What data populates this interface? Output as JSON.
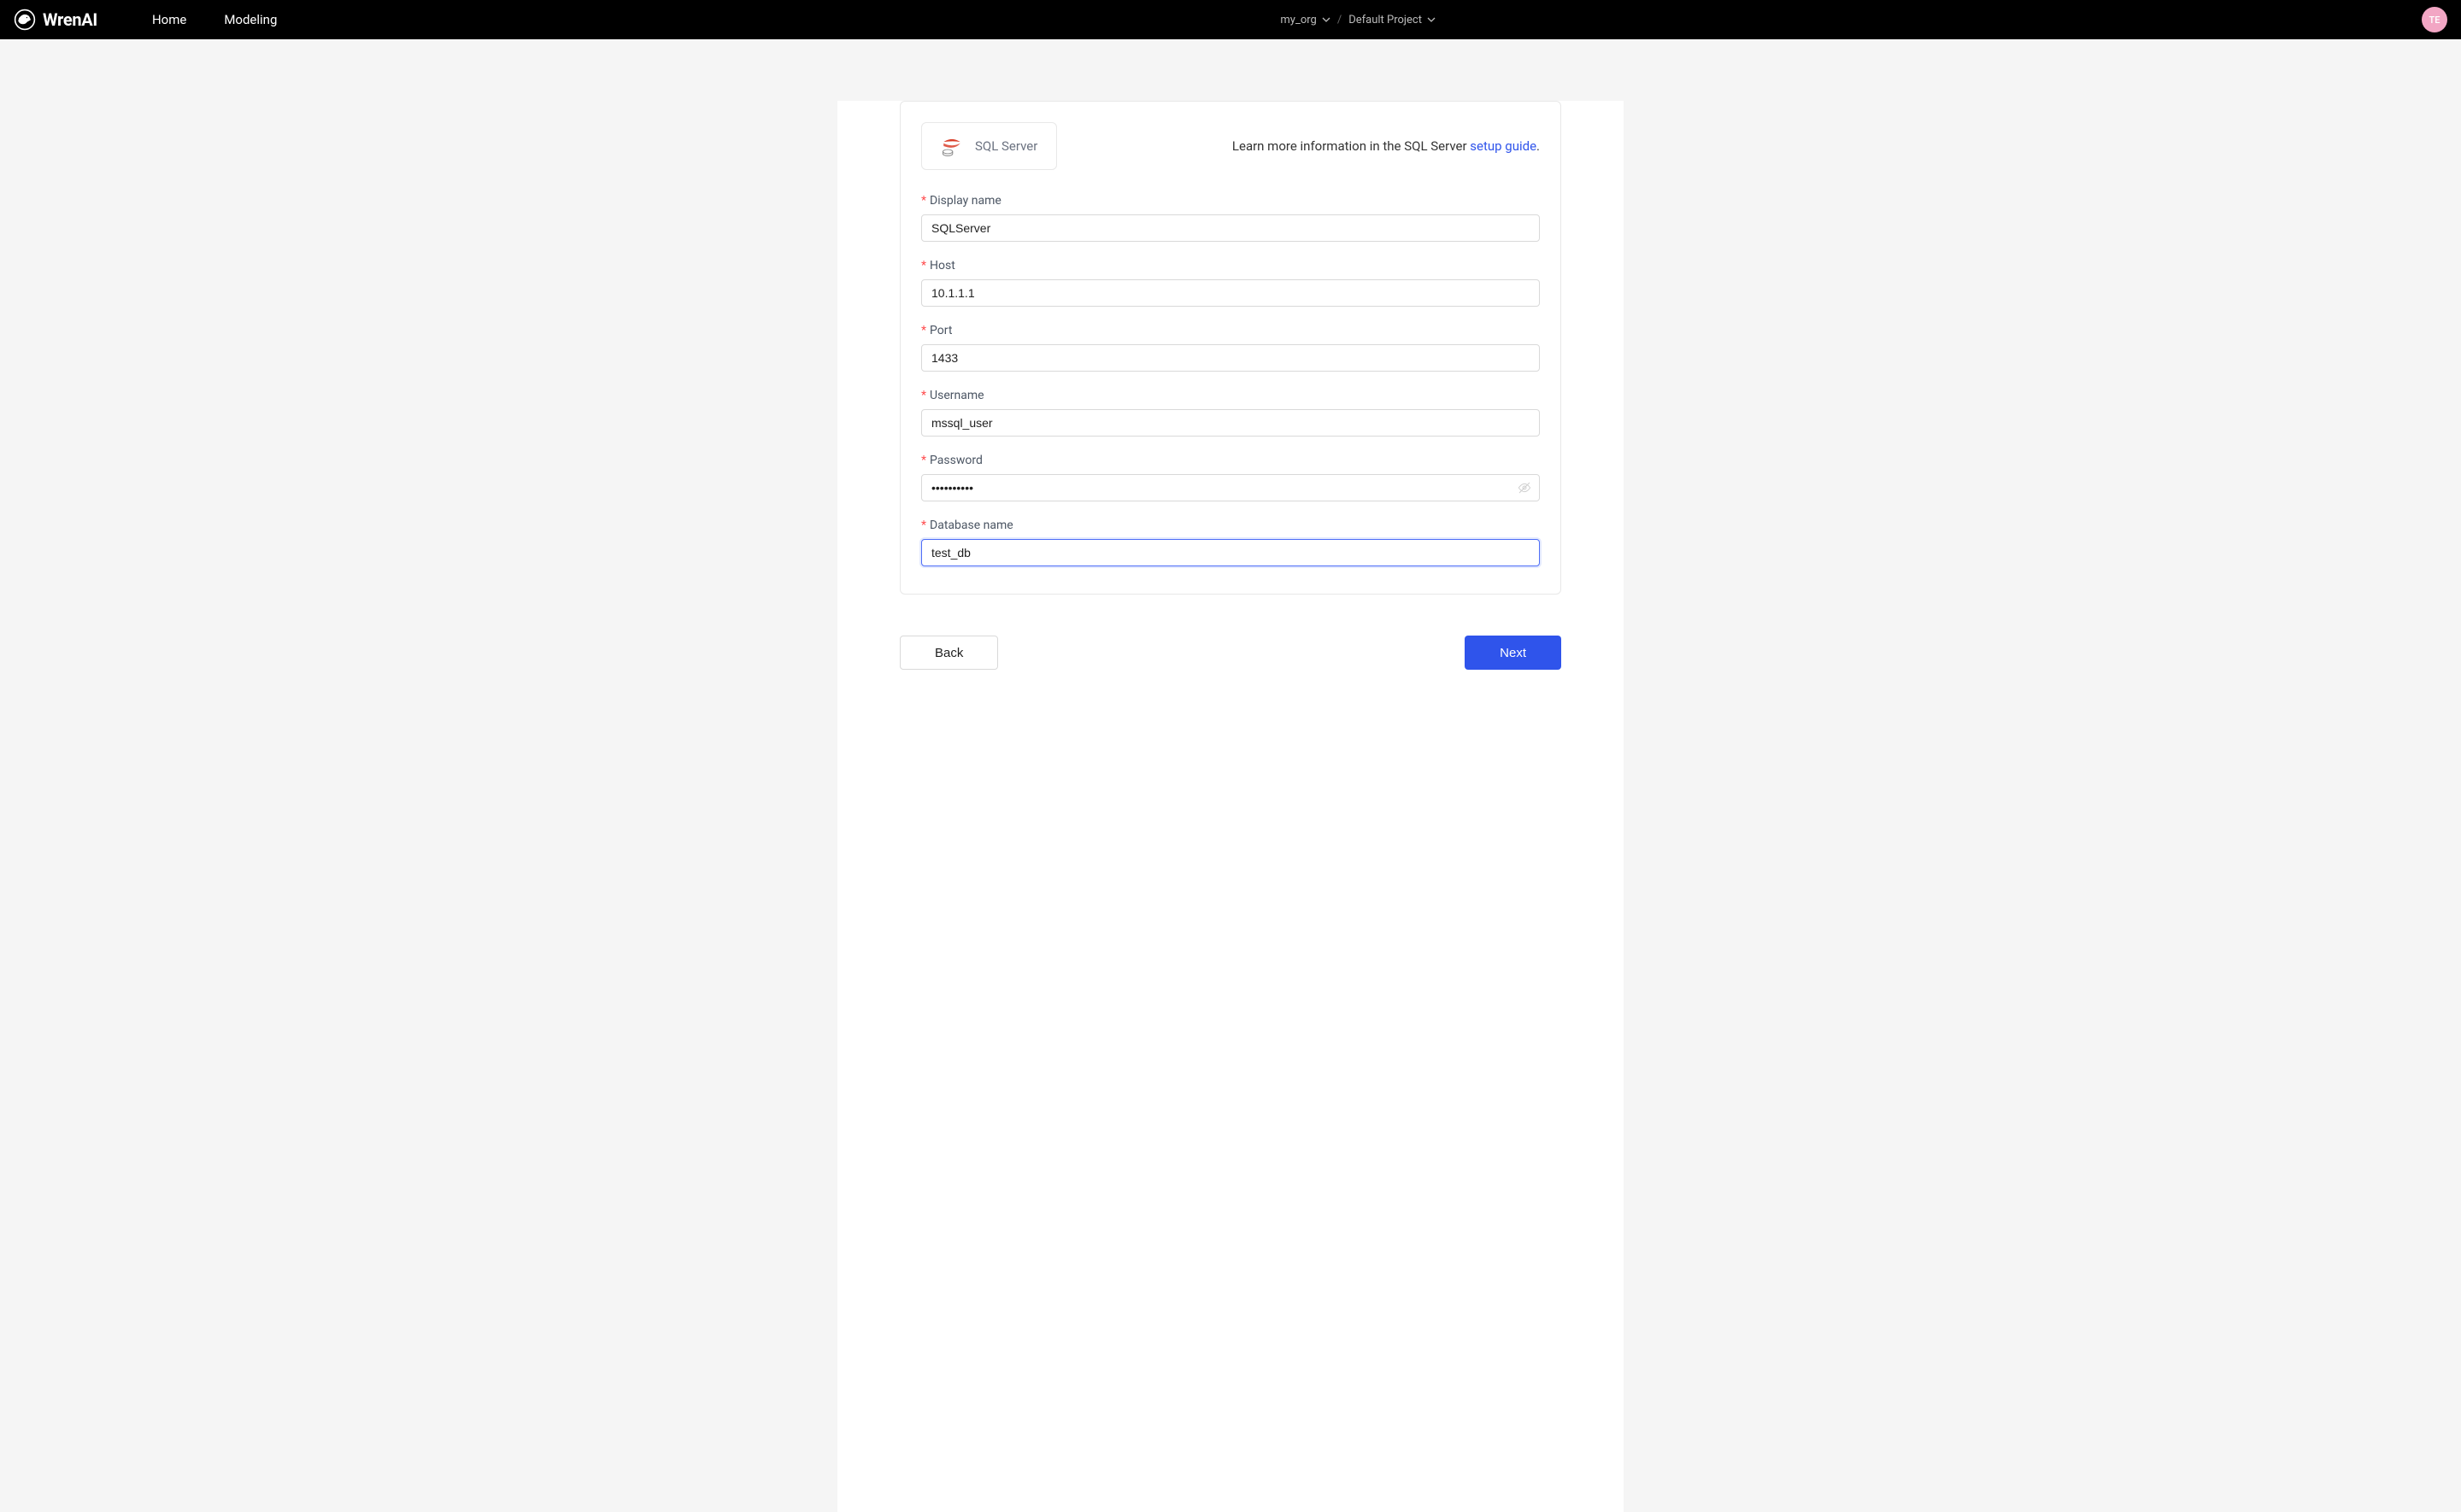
{
  "header": {
    "brand": "WrenAI",
    "nav": {
      "home": "Home",
      "modeling": "Modeling"
    },
    "org": "my_org",
    "project": "Default Project",
    "avatar_initials": "TE"
  },
  "datasource": {
    "badge_label": "SQL Server",
    "info_prefix": "Learn more information in the SQL Server ",
    "info_link": "setup guide",
    "info_suffix": "."
  },
  "form": {
    "display_name": {
      "label": "Display name",
      "value": "SQLServer"
    },
    "host": {
      "label": "Host",
      "value": "10.1.1.1"
    },
    "port": {
      "label": "Port",
      "value": "1433"
    },
    "username": {
      "label": "Username",
      "value": "mssql_user"
    },
    "password": {
      "label": "Password",
      "value": "••••••••••"
    },
    "database": {
      "label": "Database name",
      "value": "test_db"
    }
  },
  "buttons": {
    "back": "Back",
    "next": "Next"
  }
}
